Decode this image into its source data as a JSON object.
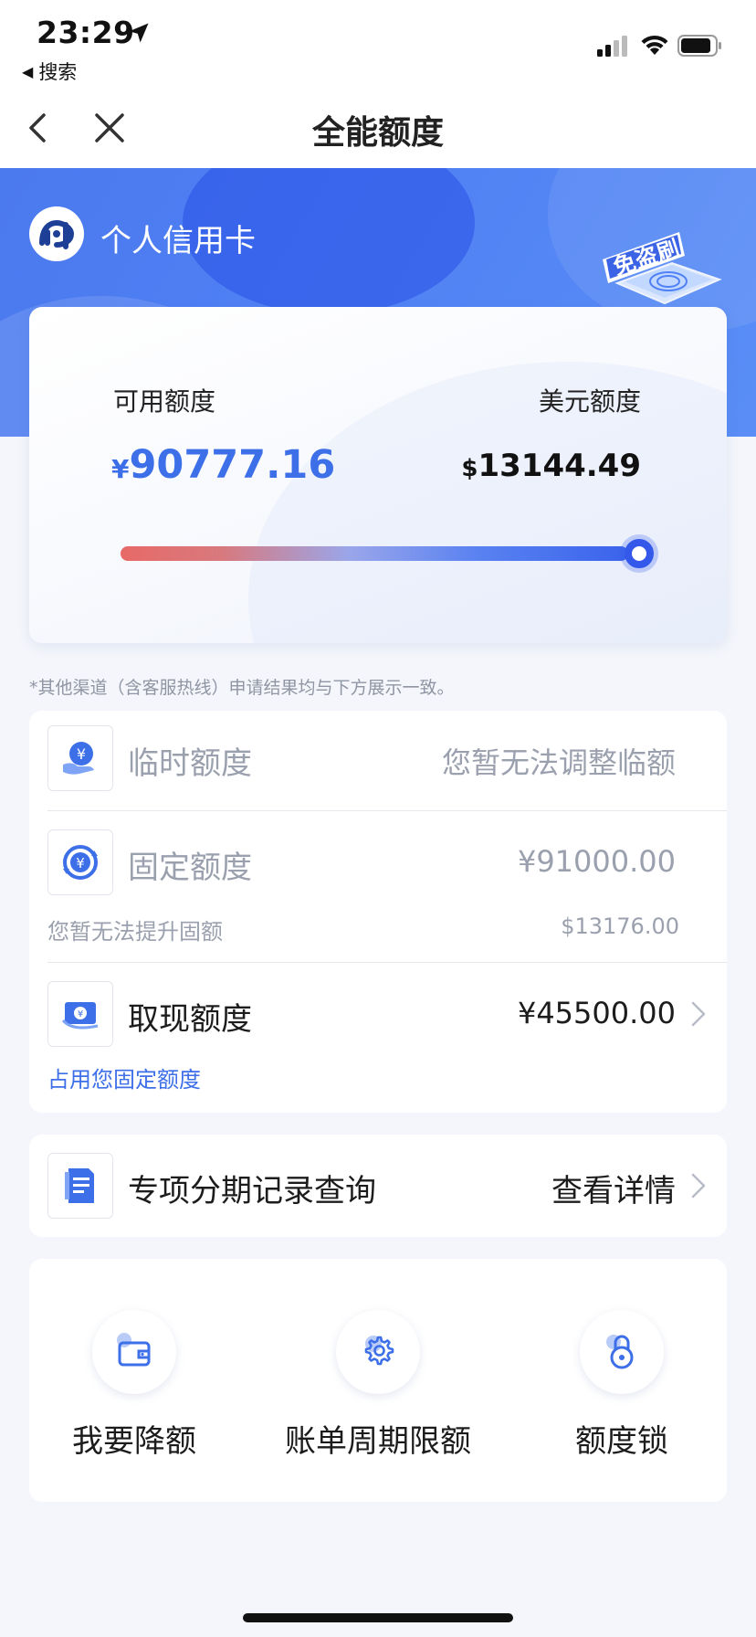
{
  "status_bar": {
    "time": "23:29",
    "back_app_label": "搜索"
  },
  "nav": {
    "title": "全能额度"
  },
  "card": {
    "name": "个人信用卡",
    "badge_text": "免盗刷"
  },
  "credit": {
    "available_label": "可用额度",
    "available_currency": "¥",
    "available_amount": "90777.16",
    "usd_label": "美元额度",
    "usd_currency": "$",
    "usd_amount": "13144.49",
    "available_ratio": 1.0
  },
  "disclaimer": "*其他渠道（含客服热线）申请结果均与下方展示一致。",
  "limits": {
    "temporary": {
      "title": "临时额度",
      "value": "您暂无法调整临额"
    },
    "fixed": {
      "title": "固定额度",
      "value": "¥91000.00",
      "sub_note": "您暂无法提升固额",
      "sub_value": "$13176.00"
    },
    "cash": {
      "title": "取现额度",
      "value": "¥45500.00",
      "sub_note": "占用您固定额度"
    }
  },
  "installment": {
    "title": "专项分期记录查询",
    "action": "查看详情"
  },
  "actions": [
    {
      "label": "我要降额",
      "icon": "wallet-icon"
    },
    {
      "label": "账单周期限额",
      "icon": "gear-icon"
    },
    {
      "label": "额度锁",
      "icon": "lock-icon"
    }
  ],
  "colors": {
    "accent": "#3d6fe8",
    "hero_blue": "#4f80f4",
    "muted_text": "#9aa0ad"
  }
}
